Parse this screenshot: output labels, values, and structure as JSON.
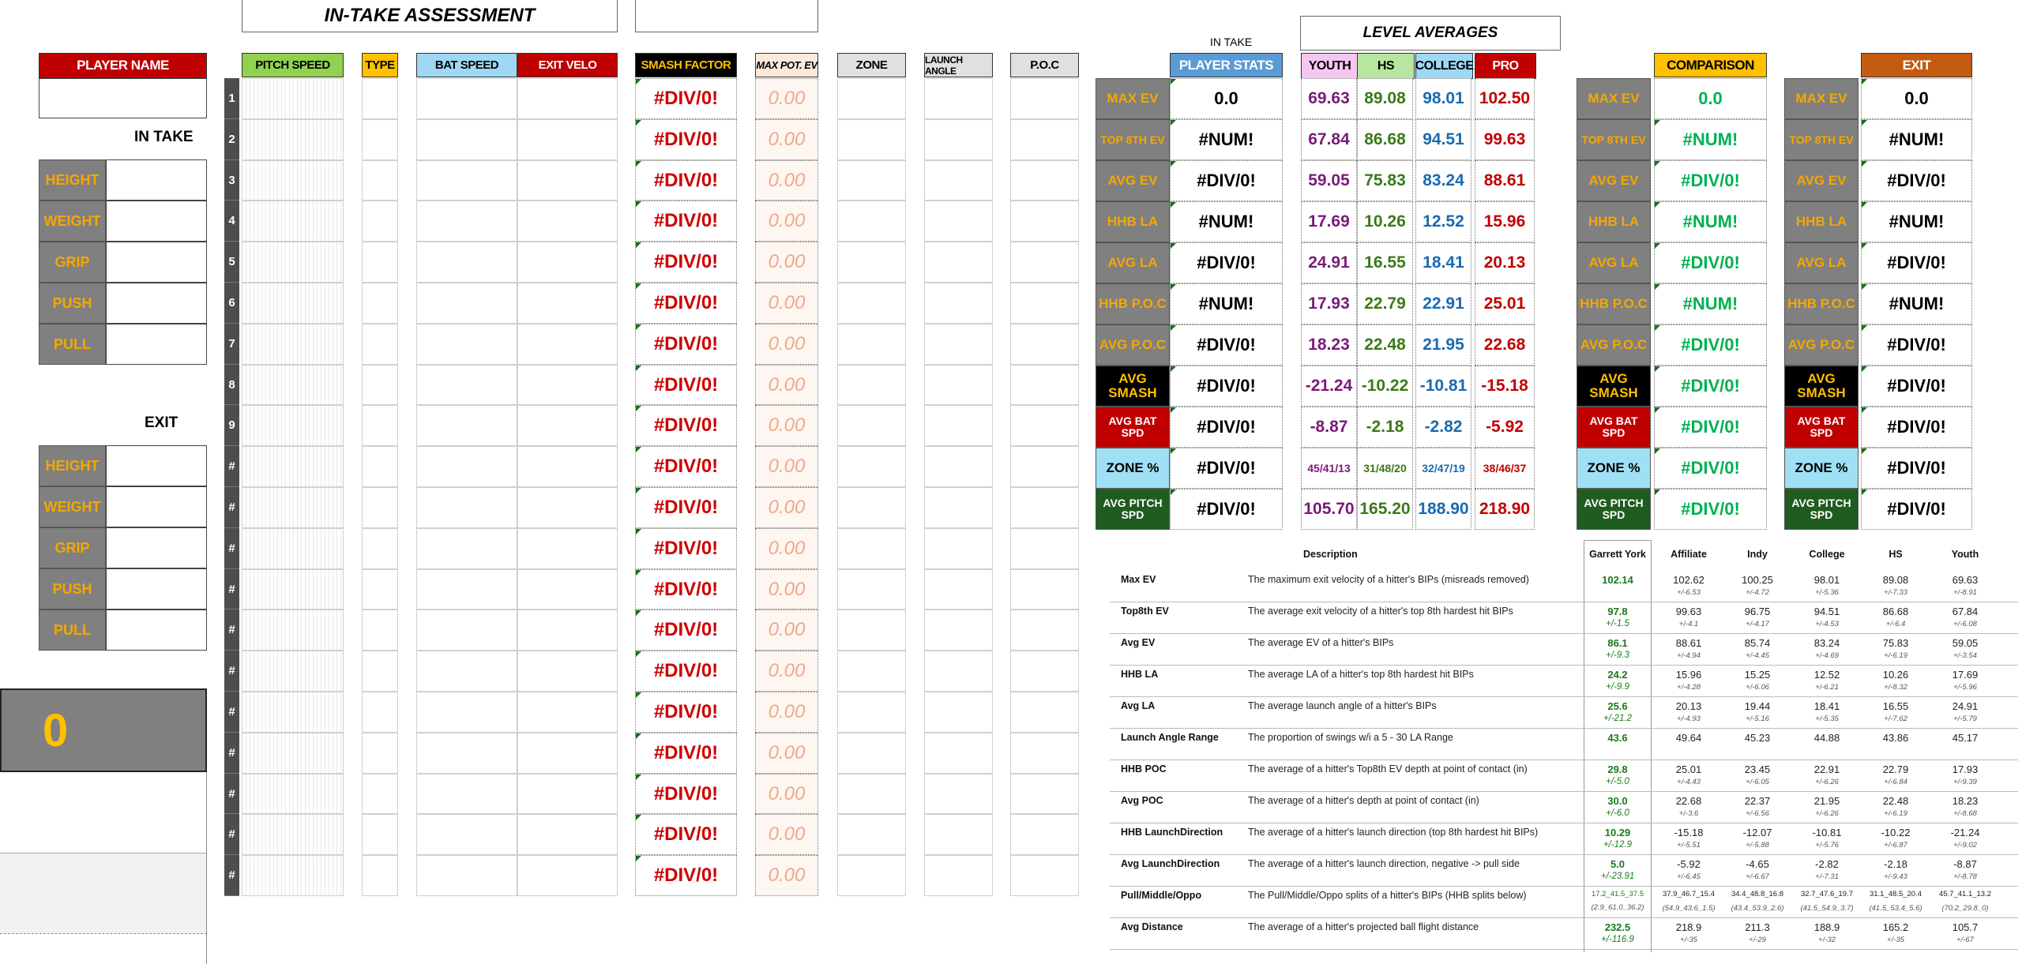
{
  "titles": {
    "intake_assessment": "IN-TAKE ASSESSMENT",
    "level_averages": "LEVEL AVERAGES",
    "in_take": "IN TAKE"
  },
  "player": {
    "name_label": "PLAYER NAME",
    "intake_label": "IN TAKE",
    "exit_label": "EXIT",
    "score": "0"
  },
  "measurements": [
    "HEIGHT",
    "WEIGHT",
    "GRIP",
    "PUSH",
    "PULL"
  ],
  "log_headers": {
    "pitch_speed": "PITCH SPEED",
    "type": "TYPE",
    "bat_speed": "BAT SPEED",
    "exit_velo": "EXIT VELO",
    "smash_factor": "SMASH FACTOR",
    "max_pot_ev": "MAX POT. EV",
    "zone": "ZONE",
    "launch_angle": "LAUNCH ANGLE",
    "poc": "P.O.C"
  },
  "row_numbers": [
    "1",
    "2",
    "3",
    "4",
    "5",
    "6",
    "7",
    "8",
    "9",
    "#",
    "#",
    "#",
    "#",
    "#",
    "#",
    "#",
    "#",
    "#",
    "#",
    "#"
  ],
  "smash_value": "#DIV/0!",
  "pot_value": "0.00",
  "stat_labels": [
    "MAX EV",
    "TOP 8TH EV",
    "AVG EV",
    "HHB LA",
    "AVG LA",
    "HHB P.O.C",
    "AVG P.O.C",
    "AVG SMASH",
    "AVG BAT SPD",
    "ZONE %",
    "AVG PITCH SPD"
  ],
  "stat_label_colors": [
    {
      "bg": "#808080",
      "fg": "#f5a700"
    },
    {
      "bg": "#808080",
      "fg": "#f5a700"
    },
    {
      "bg": "#808080",
      "fg": "#f5a700"
    },
    {
      "bg": "#808080",
      "fg": "#f5a700"
    },
    {
      "bg": "#808080",
      "fg": "#f5a700"
    },
    {
      "bg": "#808080",
      "fg": "#f5a700"
    },
    {
      "bg": "#808080",
      "fg": "#f5a700"
    },
    {
      "bg": "#000000",
      "fg": "#ffc000"
    },
    {
      "bg": "#c00000",
      "fg": "#ffffff"
    },
    {
      "bg": "#9fe0f5",
      "fg": "#000000"
    },
    {
      "bg": "#1f5c1f",
      "fg": "#ffffff"
    }
  ],
  "player_stats": {
    "header": "PLAYER STATS",
    "values": [
      "0.0",
      "#NUM!",
      "#DIV/0!",
      "#NUM!",
      "#DIV/0!",
      "#NUM!",
      "#DIV/0!",
      "#DIV/0!",
      "#DIV/0!",
      "#DIV/0!",
      "#DIV/0!"
    ]
  },
  "levels": [
    {
      "name": "YOUTH",
      "bg": "#f5c6f0",
      "color": "#7a1a7a",
      "values": [
        "69.63",
        "67.84",
        "59.05",
        "17.69",
        "24.91",
        "17.93",
        "18.23",
        "-21.24",
        "-8.87",
        "45/41/13",
        "105.70"
      ]
    },
    {
      "name": "HS",
      "bg": "#b6e6a0",
      "color": "#3a7a1a",
      "values": [
        "89.08",
        "86.68",
        "75.83",
        "10.26",
        "16.55",
        "22.79",
        "22.48",
        "-10.22",
        "-2.18",
        "31/48/20",
        "165.20"
      ]
    },
    {
      "name": "COLLEGE",
      "bg": "#9ed8f5",
      "color": "#1a6ab0",
      "values": [
        "98.01",
        "94.51",
        "83.24",
        "12.52",
        "18.41",
        "22.91",
        "21.95",
        "-10.81",
        "-2.82",
        "32/47/19",
        "188.90"
      ]
    },
    {
      "name": "PRO",
      "bg": "#c00000",
      "color": "#c00000",
      "values": [
        "102.50",
        "99.63",
        "88.61",
        "15.96",
        "20.13",
        "25.01",
        "22.68",
        "-15.18",
        "-5.92",
        "38/46/37",
        "218.90"
      ]
    }
  ],
  "comparison": {
    "header": "COMPARISON",
    "values": [
      "0.0",
      "#NUM!",
      "#DIV/0!",
      "#NUM!",
      "#DIV/0!",
      "#NUM!",
      "#DIV/0!",
      "#DIV/0!",
      "#DIV/0!",
      "#DIV/0!",
      "#DIV/0!"
    ]
  },
  "exit": {
    "header": "EXIT",
    "values": [
      "0.0",
      "#NUM!",
      "#DIV/0!",
      "#NUM!",
      "#DIV/0!",
      "#NUM!",
      "#DIV/0!",
      "#DIV/0!",
      "#DIV/0!",
      "#DIV/0!",
      "#DIV/0!"
    ]
  },
  "ref_table": {
    "headers": [
      "Description",
      "Garrett York",
      "Affiliate",
      "Indy",
      "College",
      "HS",
      "Youth"
    ],
    "rows": [
      {
        "metric": "Max EV",
        "desc": "The maximum exit velocity of a hitter's BIPs (misreads removed)",
        "gy": "102.14",
        "gy_pm": "",
        "vals": [
          "102.62",
          "100.25",
          "98.01",
          "89.08",
          "69.63"
        ],
        "pms": [
          "+/-6.53",
          "+/-4.72",
          "+/-5.36",
          "+/-7.33",
          "+/-8.91"
        ]
      },
      {
        "metric": "Top8th EV",
        "desc": "The average exit velocity of a hitter's top 8th hardest hit BIPs",
        "gy": "97.8",
        "gy_pm": "+/-1.5",
        "vals": [
          "99.63",
          "96.75",
          "94.51",
          "86.68",
          "67.84"
        ],
        "pms": [
          "+/-4.1",
          "+/-4.17",
          "+/-4.53",
          "+/-6.4",
          "+/-6.08"
        ]
      },
      {
        "metric": "Avg EV",
        "desc": "The average EV of a hitter's BIPs",
        "gy": "86.1",
        "gy_pm": "+/-9.3",
        "vals": [
          "88.61",
          "85.74",
          "83.24",
          "75.83",
          "59.05"
        ],
        "pms": [
          "+/-4.94",
          "+/-4.45",
          "+/-4.69",
          "+/-6.19",
          "+/-3.54"
        ]
      },
      {
        "metric": "HHB LA",
        "desc": "The average LA of a hitter's top 8th hardest hit BIPs",
        "gy": "24.2",
        "gy_pm": "+/-9.9",
        "vals": [
          "15.96",
          "15.25",
          "12.52",
          "10.26",
          "17.69"
        ],
        "pms": [
          "+/-4.28",
          "+/-6.06",
          "+/-6.21",
          "+/-8.32",
          "+/-5.96"
        ]
      },
      {
        "metric": "Avg LA",
        "desc": "The average launch angle of a hitter's BIPs",
        "gy": "25.6",
        "gy_pm": "+/-21.2",
        "vals": [
          "20.13",
          "19.44",
          "18.41",
          "16.55",
          "24.91"
        ],
        "pms": [
          "+/-4.93",
          "+/-5.16",
          "+/-5.35",
          "+/-7.62",
          "+/-5.79"
        ]
      },
      {
        "metric": "Launch Angle Range",
        "desc": "The proportion of swings w/i a 5 - 30 LA Range",
        "gy": "43.6",
        "gy_pm": "",
        "vals": [
          "49.64",
          "45.23",
          "44.88",
          "43.86",
          "45.17"
        ],
        "pms": [
          "",
          "",
          "",
          "",
          ""
        ]
      },
      {
        "metric": "HHB POC",
        "desc": "The average of a hitter's Top8th EV depth at point of contact (in)",
        "gy": "29.8",
        "gy_pm": "+/-5.0",
        "vals": [
          "25.01",
          "23.45",
          "22.91",
          "22.79",
          "17.93"
        ],
        "pms": [
          "+/-4.43",
          "+/-6.05",
          "+/-6.26",
          "+/-6.84",
          "+/-9.39"
        ]
      },
      {
        "metric": "Avg POC",
        "desc": "The average of a hitter's depth at point of contact (in)",
        "gy": "30.0",
        "gy_pm": "+/-6.0",
        "vals": [
          "22.68",
          "22.37",
          "21.95",
          "22.48",
          "18.23"
        ],
        "pms": [
          "+/-3.6",
          "+/-6.56",
          "+/-6.26",
          "+/-6.19",
          "+/-8.68"
        ]
      },
      {
        "metric": "HHB LaunchDirection",
        "desc": "The average of a hitter's launch direction  (top 8th hardest hit BIPs)",
        "gy": "10.29",
        "gy_pm": "+/-12.9",
        "vals": [
          "-15.18",
          "-12.07",
          "-10.81",
          "-10.22",
          "-21.24"
        ],
        "pms": [
          "+/-5.51",
          "+/-5.88",
          "+/-5.76",
          "+/-6.87",
          "+/-9.02"
        ]
      },
      {
        "metric": "Avg LaunchDirection",
        "desc": "The average of a hitter's launch direction, negative -> pull side",
        "gy": "5.0",
        "gy_pm": "+/-23.91",
        "vals": [
          "-5.92",
          "-4.65",
          "-2.82",
          "-2.18",
          "-8.87"
        ],
        "pms": [
          "+/-6.45",
          "+/-6.67",
          "+/-7.31",
          "+/-9.43",
          "+/-8.78"
        ]
      },
      {
        "metric": "Pull/Middle/Oppo",
        "desc": "The Pull/Middle/Oppo splits of a hitter's BIPs (HHB splits below)",
        "gy": "17.2_41.5_37.5",
        "gy_pm": "(2.9_61.0_36.2)",
        "vals": [
          "37.9_46.7_15.4",
          "34.4_48.8_16.8",
          "32.7_47.6_19.7",
          "31.1_48.5_20.4",
          "45.7_41.1_13.2"
        ],
        "pms": [
          "(54.9_43.6_1.5)",
          "(43.4_53.9_2.6)",
          "(41.5_54.9_3.7)",
          "(41.5_53.4_5.6)",
          "(70.2_29.8_0)"
        ]
      },
      {
        "metric": "Avg Distance",
        "desc": "The average of a hitter's projected ball flight distance",
        "gy": "232.5",
        "gy_pm": "+/-116.9",
        "vals": [
          "218.9",
          "211.3",
          "188.9",
          "165.2",
          "105.7"
        ],
        "pms": [
          "+/-35",
          "+/-29",
          "+/-32",
          "+/-35",
          "+/-67"
        ]
      }
    ]
  },
  "colors": {
    "pitch_speed_bg": "#92d050",
    "type_bg": "#ffc000",
    "bat_speed_bg": "#9ed8f5",
    "exit_velo_bg": "#c00000",
    "smash_bg": "#000000",
    "smash_fg": "#ffc000",
    "player_name_bg": "#c00000",
    "player_stats_bg": "#5b9bd5",
    "comparison_bg": "#ffc000",
    "exit_bg": "#c55a11",
    "accent_green": "#00b050"
  }
}
